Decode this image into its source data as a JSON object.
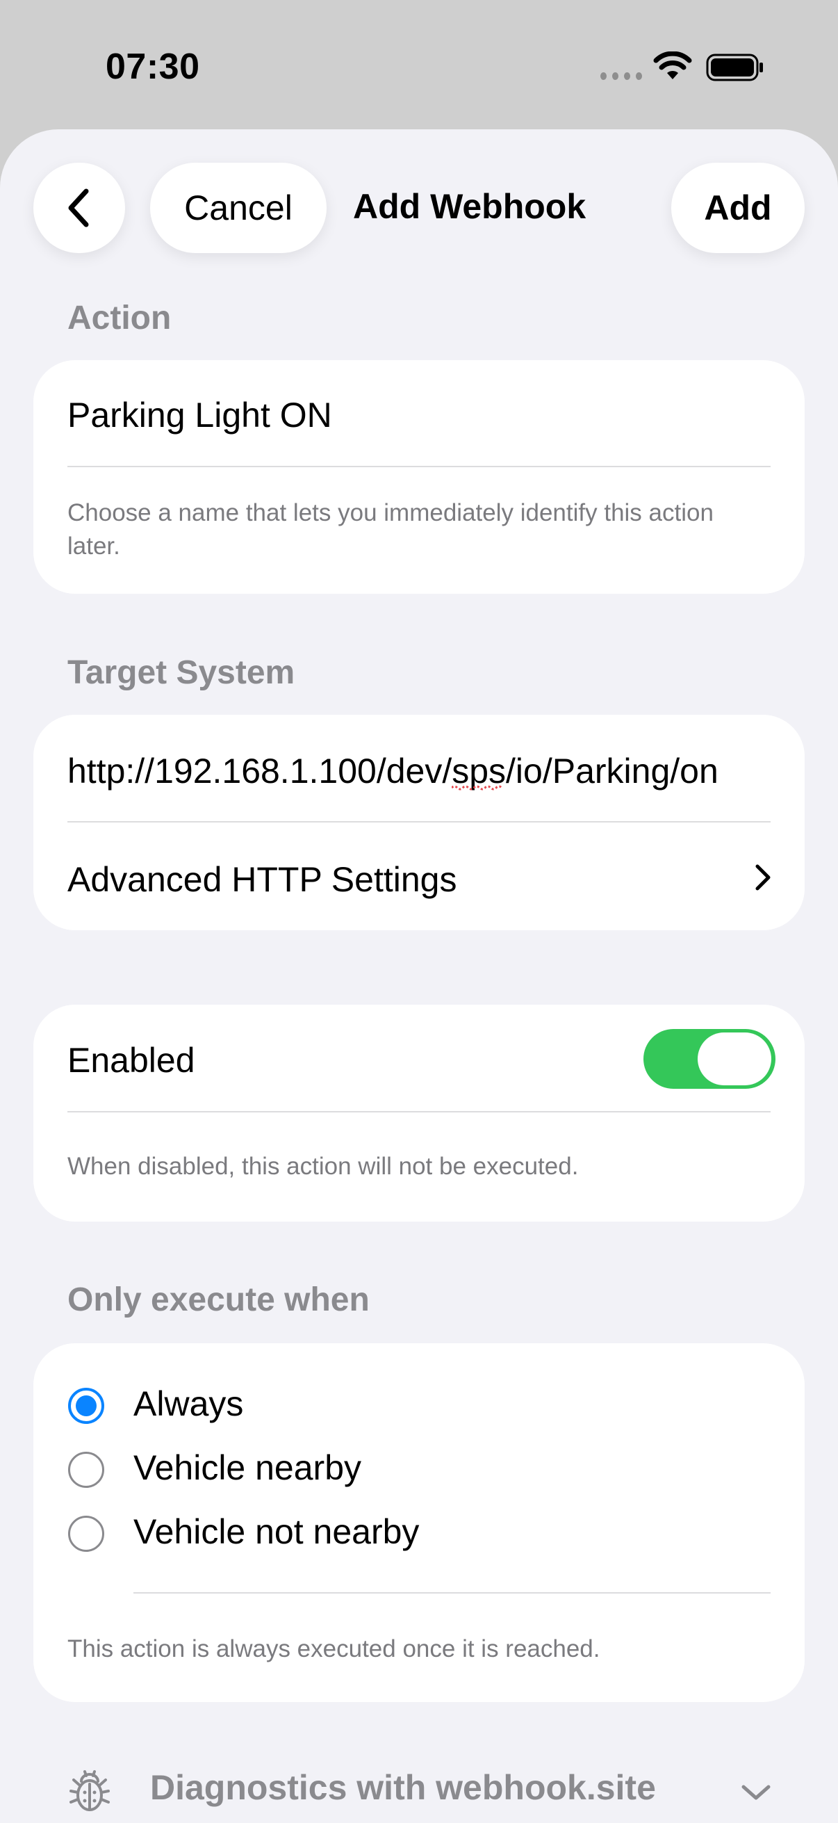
{
  "status_bar": {
    "time": "07:30"
  },
  "nav": {
    "cancel_label": "Cancel",
    "title": "Add Webhook",
    "add_label": "Add"
  },
  "action_section": {
    "header": "Action",
    "name_value": "Parking Light ON",
    "footnote": "Choose a name that lets you immediately identify this action later."
  },
  "target_section": {
    "header": "Target System",
    "url_value": "http://192.168.1.100/dev/sps/io/Parking/on",
    "advanced_label": "Advanced HTTP Settings"
  },
  "enabled_section": {
    "label": "Enabled",
    "enabled": true,
    "footnote": "When disabled, this action will not be executed."
  },
  "execute_section": {
    "header": "Only execute when",
    "options": [
      {
        "label": "Always",
        "selected": true
      },
      {
        "label": "Vehicle nearby",
        "selected": false
      },
      {
        "label": "Vehicle not nearby",
        "selected": false
      }
    ],
    "footnote": "This action is always executed once it is reached."
  },
  "diagnostics": {
    "label": "Diagnostics with webhook.site"
  },
  "colors": {
    "accent": "#0a84ff",
    "toggle_on": "#34c759",
    "background": "#f2f2f7"
  },
  "icons": [
    "back-chevron-icon",
    "chevron-right-icon",
    "bug-icon",
    "chevron-down-icon",
    "wifi-icon",
    "battery-icon"
  ]
}
